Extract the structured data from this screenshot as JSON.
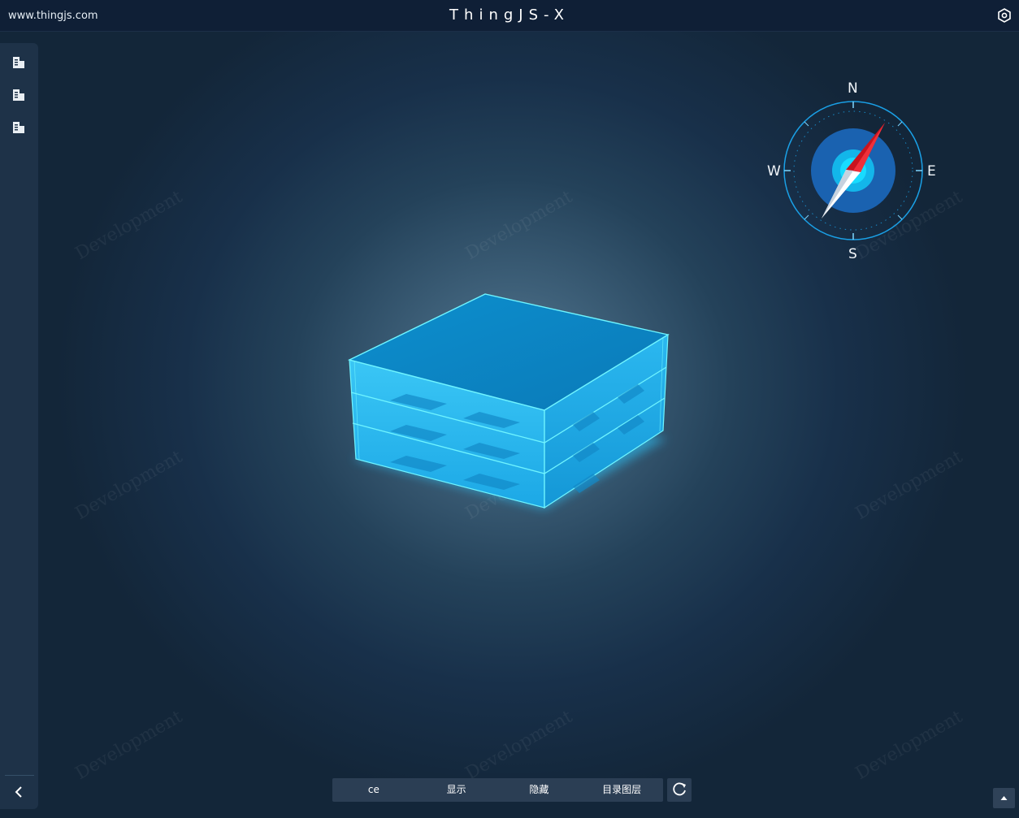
{
  "header": {
    "site_url": "www.thingjs.com",
    "title": "ThingJS-X",
    "settings_icon": "settings-hex-icon"
  },
  "sidebar": {
    "items": [
      {
        "icon": "building-icon"
      },
      {
        "icon": "building-icon"
      },
      {
        "icon": "building-icon"
      }
    ],
    "collapse_icon": "chevron-left-icon"
  },
  "compass": {
    "north": "N",
    "east": "E",
    "south": "S",
    "west": "W"
  },
  "watermark_text": "Development",
  "toolbar": {
    "buttons": [
      {
        "label": "ce"
      },
      {
        "label": "显示"
      },
      {
        "label": "隐藏"
      },
      {
        "label": "目录图层"
      }
    ],
    "refresh_icon": "refresh-icon"
  },
  "corner": {
    "icon": "caret-up-icon"
  },
  "colors": {
    "topbar": "#0f1f36",
    "sidebar": "#1e3248",
    "building": "#1aa6e0",
    "building_edge": "#5ff0ff",
    "compass_blue": "#1aa0e6",
    "needle_red": "#d81e2c"
  }
}
